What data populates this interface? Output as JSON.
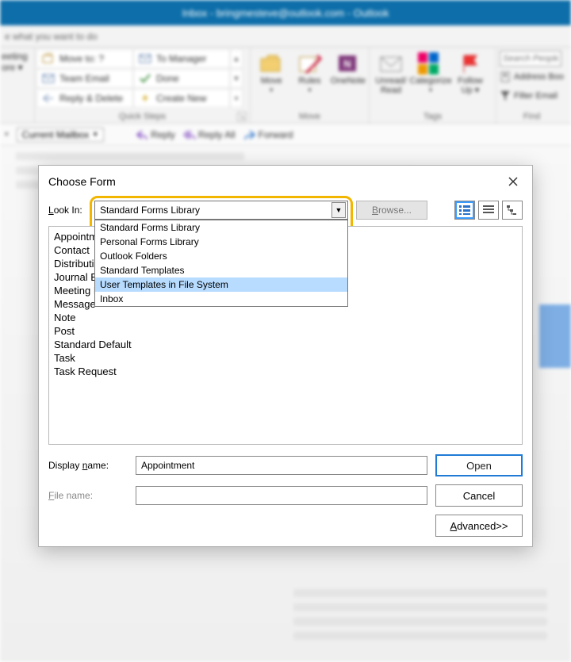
{
  "titlebar": "Inbox - bringmesteve@outlook.com  -  Outlook",
  "tellme": "e what you want to do",
  "ribbon": {
    "meeting": {
      "line1": "eeting",
      "line2": "ore ▾"
    },
    "quicksteps": {
      "label": "Quick Steps",
      "items": [
        {
          "icon": "move-icon",
          "text": "Move to: ?"
        },
        {
          "icon": "to-manager-icon",
          "text": "To Manager"
        },
        {
          "icon": "team-email-icon",
          "text": "Team Email"
        },
        {
          "icon": "done-icon",
          "text": "Done"
        },
        {
          "icon": "reply-delete-icon",
          "text": "Reply & Delete"
        },
        {
          "icon": "create-new-icon",
          "text": "Create New"
        }
      ]
    },
    "move": {
      "label": "Move",
      "move_btn": "Move",
      "rules_btn": "Rules",
      "onenote_btn": "OneNote"
    },
    "tags": {
      "label": "Tags",
      "unread_btn": "Unread/\nRead",
      "categorize_btn": "Categorize",
      "followup_btn": "Follow\nUp ▾"
    },
    "find": {
      "label": "Find",
      "search_placeholder": "Search People",
      "address_book": "Address Boo",
      "filter": "Filter Email"
    }
  },
  "subbar": {
    "current_mailbox": "Current Mailbox",
    "reply": "Reply",
    "replyall": "Reply All",
    "forward": "Forward"
  },
  "dialog": {
    "title": "Choose Form",
    "lookin_label": "Look In:",
    "combo_value": "Standard Forms Library",
    "dropdown": [
      "Standard Forms Library",
      "Personal Forms Library",
      "Outlook Folders",
      "Standard Templates",
      "User Templates in File System",
      "Inbox"
    ],
    "dropdown_selected_index": 4,
    "browse": "Browse...",
    "forms": [
      "Appointment",
      "Contact",
      "Distribution List",
      "Journal Entry",
      "Meeting Request",
      "Message",
      "Note",
      "Post",
      "Standard Default",
      "Task",
      "Task Request"
    ],
    "display_name_label": "Display name:",
    "display_name_value": "Appointment",
    "file_name_label": "File name:",
    "file_name_value": "",
    "open": "Open",
    "cancel": "Cancel",
    "advanced": "Advanced>>"
  }
}
